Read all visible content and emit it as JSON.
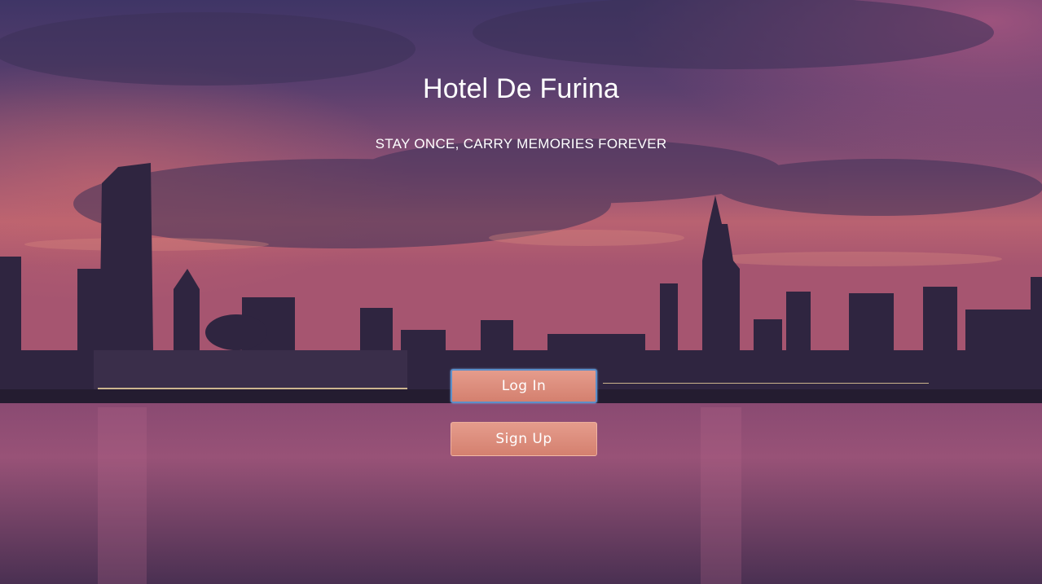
{
  "hero": {
    "title": "Hotel De Furina",
    "tagline": "STAY ONCE, CARRY MEMORIES FOREVER",
    "background": "city-skyline-sunset-over-lake"
  },
  "actions": {
    "login_label": "Log In",
    "signup_label": "Sign Up",
    "focused": "login"
  },
  "colors": {
    "button": "#dd8e7e",
    "focus_ring": "#5d8fc9",
    "text": "#ffffff"
  }
}
